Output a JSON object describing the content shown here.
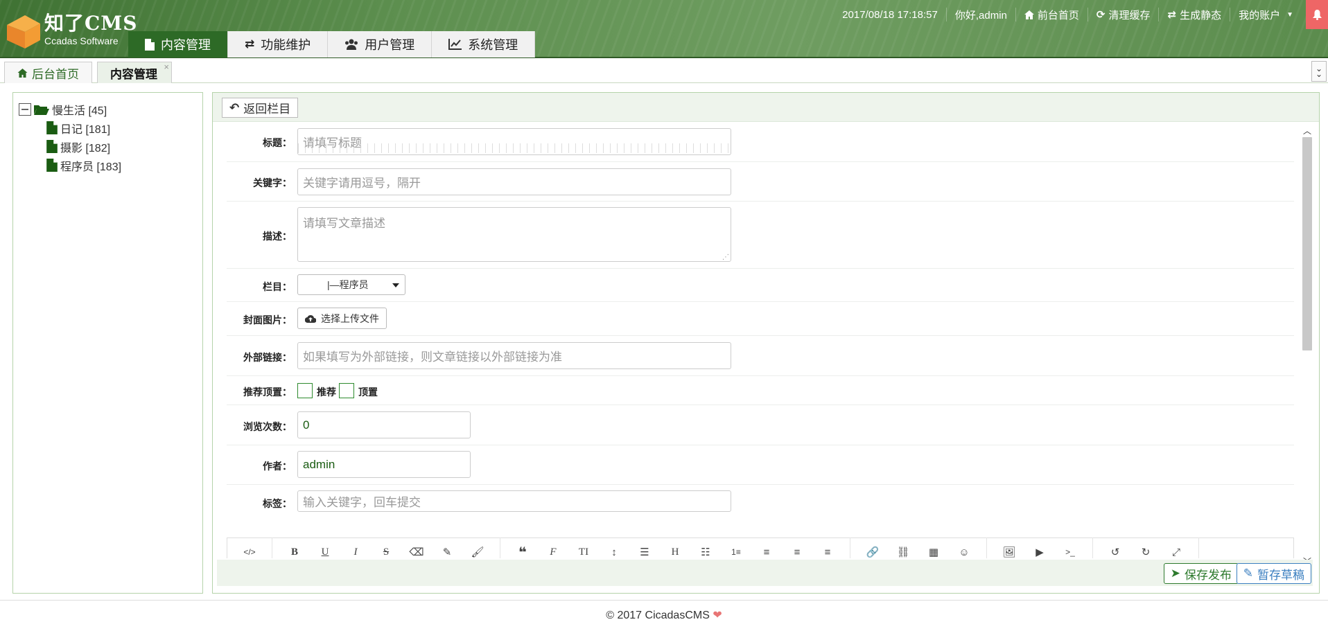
{
  "brand": {
    "title": "知了CMS",
    "subtitle": "Ccadas Software",
    "logo_color": "#f39c34"
  },
  "header": {
    "datetime": "2017/08/18 17:18:57",
    "greeting": "你好,admin",
    "links": {
      "front_home": "前台首页",
      "clear_cache": "清理缓存",
      "generate_static": "生成静态",
      "my_account": "我的账户"
    }
  },
  "main_nav": [
    {
      "label": "内容管理",
      "icon": "file-icon",
      "active": true
    },
    {
      "label": "功能维护",
      "icon": "retweet-icon",
      "active": false
    },
    {
      "label": "用户管理",
      "icon": "users-icon",
      "active": false
    },
    {
      "label": "系统管理",
      "icon": "chart-icon",
      "active": false
    }
  ],
  "tabs": [
    {
      "label": "后台首页",
      "icon": "home-icon",
      "active": false
    },
    {
      "label": "内容管理",
      "active": true,
      "close": "×"
    }
  ],
  "tree": {
    "root": {
      "label": "慢生活 [45]"
    },
    "children": [
      {
        "label": "日记 [181]"
      },
      {
        "label": "摄影 [182]"
      },
      {
        "label": "程序员 [183]"
      }
    ]
  },
  "content": {
    "back_label": "返回栏目",
    "form": {
      "title": {
        "label": "标题：",
        "placeholder": "请填写标题"
      },
      "keywords": {
        "label": "关键字：",
        "placeholder": "关键字请用逗号，隔开"
      },
      "description": {
        "label": "描述：",
        "placeholder": "请填写文章描述"
      },
      "category": {
        "label": "栏目：",
        "value": "|—程序员"
      },
      "cover": {
        "label": "封面图片：",
        "button": "选择上传文件"
      },
      "external_link": {
        "label": "外部链接：",
        "placeholder": "如果填写为外部链接，则文章链接以外部链接为准"
      },
      "recommend_top": {
        "label": "推荐顶置：",
        "recommend": "推荐",
        "top": "顶置",
        "recommend_checked": false,
        "top_checked": false
      },
      "views": {
        "label": "浏览次数：",
        "value": "0"
      },
      "author": {
        "label": "作者：",
        "value": "admin"
      },
      "tags": {
        "label": "标签：",
        "placeholder": "输入关键字，回车提交"
      }
    },
    "toolbar": [
      [
        "code-icon"
      ],
      [
        "bold-icon",
        "underline-icon",
        "italic-icon",
        "strikethrough-icon",
        "eraser-icon",
        "pencil-icon",
        "brush-icon"
      ],
      [
        "quote-icon",
        "font-icon",
        "font-size-icon",
        "line-height-icon",
        "indent-icon",
        "heading-icon",
        "unordered-list-icon",
        "ordered-list-icon",
        "align-left-icon",
        "align-center-icon",
        "align-right-icon"
      ],
      [
        "link-icon",
        "unlink-icon",
        "table-icon",
        "emoji-icon"
      ],
      [
        "image-icon",
        "video-icon",
        "terminal-icon"
      ],
      [
        "undo-icon",
        "redo-icon",
        "fullscreen-icon"
      ]
    ],
    "save_label": "保存发布",
    "draft_label": "暂存草稿"
  },
  "footer": {
    "text": "© 2017 CicadasCMS"
  },
  "colors": {
    "accent": "#2d6a26",
    "header_bg": "#5d8f4f",
    "draft": "#3b7fc0",
    "heart": "#e87575"
  }
}
